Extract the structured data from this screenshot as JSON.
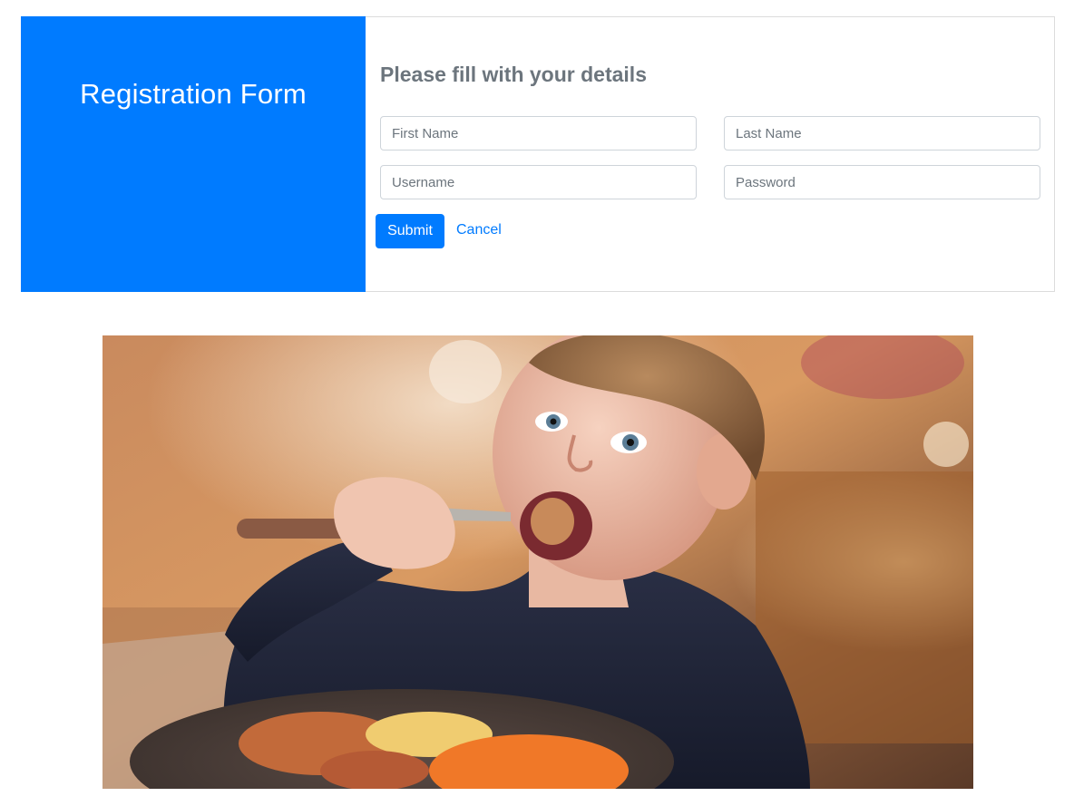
{
  "sidebar": {
    "title": "Registration Form",
    "background": "#007bff"
  },
  "form": {
    "heading": "Please fill with your details",
    "first_name_placeholder": "First Name",
    "last_name_placeholder": "Last Name",
    "username_placeholder": "Username",
    "password_placeholder": "Password",
    "submit_label": "Submit",
    "cancel_label": "Cancel",
    "accent": "#007bff"
  },
  "image": {
    "subject": "child-eating-photo"
  }
}
